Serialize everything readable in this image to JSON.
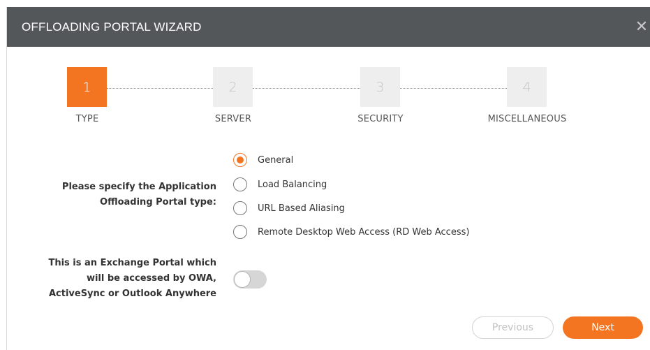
{
  "dialog": {
    "title": "OFFLOADING PORTAL WIZARD",
    "close_icon": "close-icon"
  },
  "steps": [
    {
      "number": "1",
      "label": "TYPE",
      "state": "active"
    },
    {
      "number": "2",
      "label": "SERVER",
      "state": "inactive"
    },
    {
      "number": "3",
      "label": "SECURITY",
      "state": "inactive"
    },
    {
      "number": "4",
      "label": "MISCELLANEOUS",
      "state": "inactive"
    }
  ],
  "portal_type": {
    "label_line1": "Please specify the Application",
    "label_line2": "Offloading Portal type:",
    "options": [
      {
        "label": "General",
        "selected": true
      },
      {
        "label": "Load Balancing",
        "selected": false
      },
      {
        "label": "URL Based Aliasing",
        "selected": false
      },
      {
        "label": "Remote Desktop Web Access (RD Web Access)",
        "selected": false
      }
    ]
  },
  "exchange_portal": {
    "label_line1": "This is an Exchange Portal which",
    "label_line2": "will be accessed by OWA,",
    "label_line3": "ActiveSync or Outlook Anywhere",
    "enabled": false
  },
  "buttons": {
    "previous": "Previous",
    "next": "Next"
  },
  "colors": {
    "accent": "#f47521",
    "titlebar": "#53575a"
  }
}
